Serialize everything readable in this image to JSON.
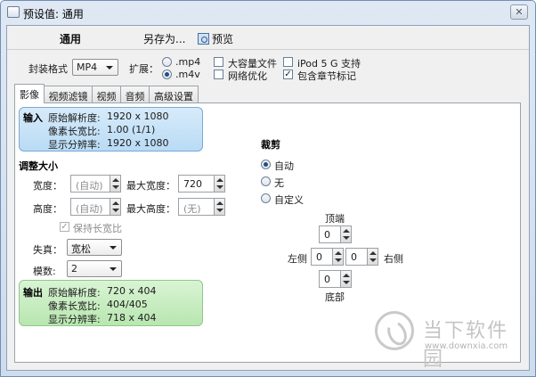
{
  "window": {
    "title": "预设值: 通用",
    "close_glyph": "✕"
  },
  "toolbar": {
    "general": "通用",
    "save_as": "另存为...",
    "preview": "预览"
  },
  "format": {
    "label": "封装格式",
    "value": "MP4",
    "ext_label": "扩展：",
    "ext_options": [
      {
        "label": ".mp4",
        "selected": false
      },
      {
        "label": ".m4v",
        "selected": true
      }
    ],
    "checkboxes": [
      {
        "label": "大容量文件",
        "checked": false
      },
      {
        "label": "网络优化",
        "checked": false
      },
      {
        "label": "iPod 5 G 支持",
        "checked": false
      },
      {
        "label": "包含章节标记",
        "checked": true
      }
    ]
  },
  "tabs": [
    {
      "label": "影像",
      "active": true
    },
    {
      "label": "视频滤镜",
      "active": false
    },
    {
      "label": "视频",
      "active": false
    },
    {
      "label": "音频",
      "active": false
    },
    {
      "label": "高级设置",
      "active": false
    }
  ],
  "input_box": {
    "heading": "输入",
    "rows": [
      {
        "label": "原始解析度:",
        "value": "1920 x 1080"
      },
      {
        "label": "像素长宽比:",
        "value": "1.00 (1/1)"
      },
      {
        "label": "显示分辨率:",
        "value": "1920 x 1080"
      }
    ]
  },
  "resize": {
    "heading": "调整大小",
    "width_label": "宽度：",
    "width_value": "(自动)",
    "max_width_label": "最大宽度：",
    "max_width_value": "720",
    "height_label": "高度：",
    "height_value": "(自动)",
    "max_height_label": "最大高度：",
    "max_height_value": "(无)",
    "keep_ratio_label": "保持长宽比",
    "keep_ratio_checked": true,
    "distortion_label": "失真：",
    "distortion_value": "宽松",
    "modulus_label": "模数:",
    "modulus_value": "2"
  },
  "output_box": {
    "heading": "输出",
    "rows": [
      {
        "label": "原始解析度:",
        "value": "720 x 404"
      },
      {
        "label": "像素长宽比:",
        "value": "404/405"
      },
      {
        "label": "显示分辨率:",
        "value": "718 x 404"
      }
    ]
  },
  "crop": {
    "heading": "裁剪",
    "options": [
      {
        "label": "自动",
        "selected": true
      },
      {
        "label": "无",
        "selected": false
      },
      {
        "label": "自定义",
        "selected": false
      }
    ],
    "top_label": "顶端",
    "top_value": "0",
    "left_label": "左侧",
    "left_value": "0",
    "right_label": "右侧",
    "right_value": "0",
    "bottom_label": "底部",
    "bottom_value": "0"
  },
  "watermark": {
    "name": "当下软件园",
    "url": "www.downxia.com"
  }
}
